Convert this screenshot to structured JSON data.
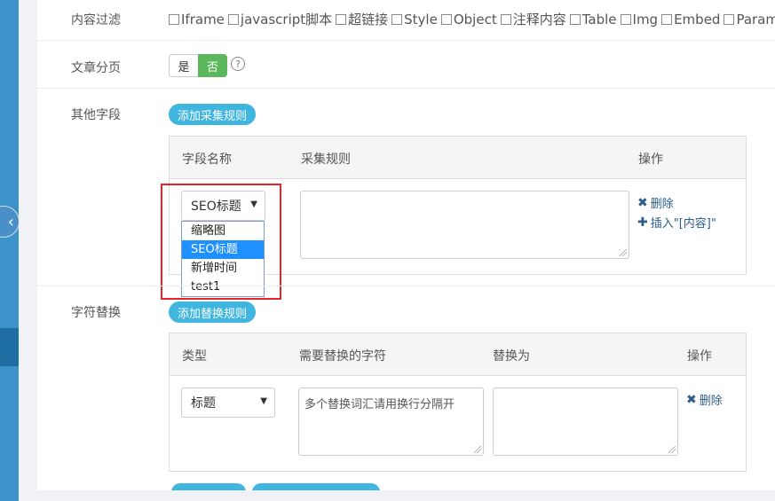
{
  "form": {
    "content_filter": {
      "label": "内容过滤",
      "options": [
        "Iframe",
        "javascript脚本",
        "超链接",
        "Style",
        "Object",
        "注释内容",
        "Table",
        "Img",
        "Embed",
        "Param"
      ]
    },
    "pagination": {
      "label": "文章分页",
      "yes": "是",
      "no": "否",
      "selected": "否",
      "help_icon": "question-circle-icon"
    },
    "other_fields": {
      "label": "其他字段",
      "add_button": "添加采集规则",
      "headers": [
        "字段名称",
        "采集规则",
        "操作"
      ],
      "row": {
        "select_value": "SEO标题",
        "rule_value": "",
        "delete_label": "删除",
        "insert_label": "插入\"[内容]\""
      },
      "dropdown_options": [
        "缩略图",
        "SEO标题",
        "新增时间",
        "test1"
      ],
      "dropdown_selected": "SEO标题"
    },
    "replace": {
      "label": "字符替换",
      "add_button": "添加替换规则",
      "headers": [
        "类型",
        "需要替换的字符",
        "替换为",
        "操作"
      ],
      "row": {
        "type_value": "标题",
        "find_placeholder": "多个替换词汇请用换行分隔开",
        "replace_value": "",
        "delete_label": "删除"
      }
    }
  },
  "colors": {
    "primary": "#3fb5e0",
    "toggle_on": "#5cb85c",
    "highlight": "#e8242a",
    "dropdown_selected": "#1e90ff",
    "sidebar": "#3c93c9"
  }
}
